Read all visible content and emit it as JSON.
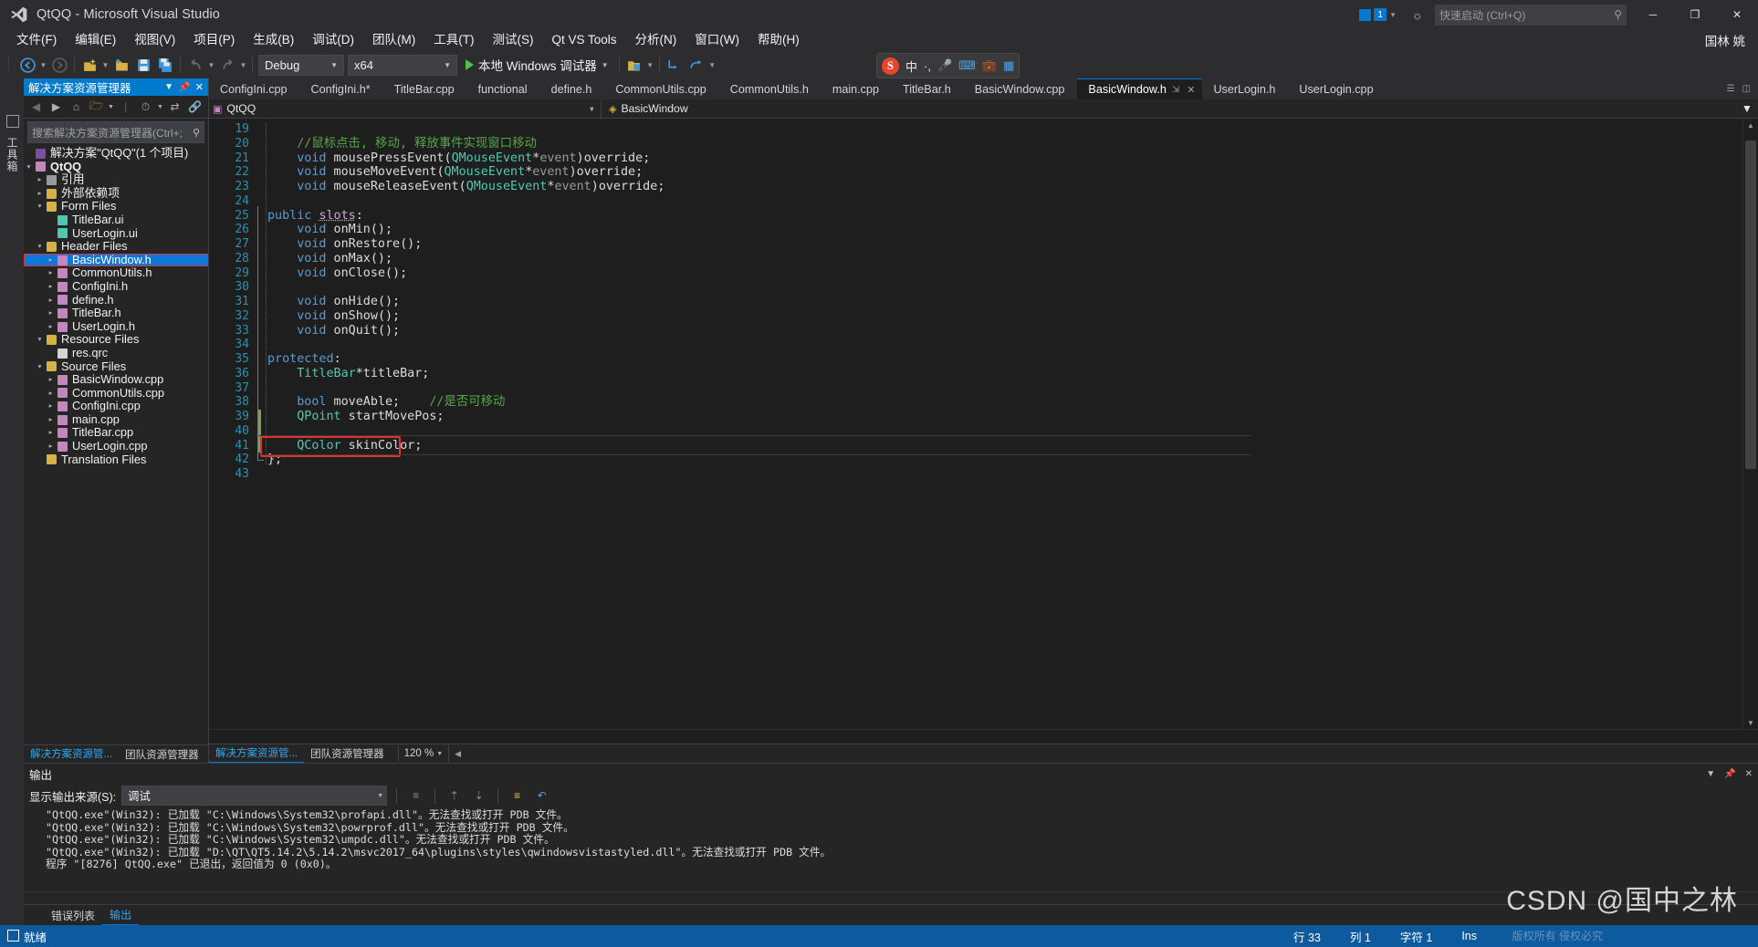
{
  "titlebar": {
    "title": "QtQQ - Microsoft Visual Studio",
    "notif_count": "1",
    "search_placeholder": "快速启动 (Ctrl+Q)",
    "minimize": "─",
    "maximize": "❐",
    "close": "✕"
  },
  "menubar": {
    "items": [
      {
        "label": "文件(F)"
      },
      {
        "label": "编辑(E)"
      },
      {
        "label": "视图(V)"
      },
      {
        "label": "项目(P)"
      },
      {
        "label": "生成(B)"
      },
      {
        "label": "调试(D)"
      },
      {
        "label": "团队(M)"
      },
      {
        "label": "工具(T)"
      },
      {
        "label": "测试(S)"
      },
      {
        "label": "Qt VS Tools"
      },
      {
        "label": "分析(N)"
      },
      {
        "label": "窗口(W)"
      },
      {
        "label": "帮助(H)"
      }
    ],
    "user": "国林 姚"
  },
  "toolbar": {
    "config": "Debug",
    "platform": "x64",
    "run_label": "本地 Windows 调试器",
    "sogou": {
      "logo": "S",
      "lang": "中",
      "dot": "·,"
    }
  },
  "solution_explorer": {
    "title": "解决方案资源管理器",
    "search_placeholder": "搜索解决方案资源管理器(Ctrl+;",
    "root": "解决方案\"QtQQ\"(1 个项目)",
    "project": "QtQQ",
    "tree": [
      {
        "label": "引用",
        "indent": 2,
        "arrow": "▸",
        "icon": "reference-icon",
        "color": "#9a9a9a"
      },
      {
        "label": "外部依赖项",
        "indent": 2,
        "arrow": "▸",
        "icon": "folder-icon",
        "color": "#d7b047"
      },
      {
        "label": "Form Files",
        "indent": 2,
        "arrow": "▾",
        "icon": "filter-folder-icon",
        "color": "#d7b047"
      },
      {
        "label": "TitleBar.ui",
        "indent": 3,
        "arrow": "",
        "icon": "ui-file-icon",
        "color": "#4ec9b0"
      },
      {
        "label": "UserLogin.ui",
        "indent": 3,
        "arrow": "",
        "icon": "ui-file-icon",
        "color": "#4ec9b0"
      },
      {
        "label": "Header Files",
        "indent": 2,
        "arrow": "▾",
        "icon": "filter-folder-icon",
        "color": "#d7b047"
      },
      {
        "label": "BasicWindow.h",
        "indent": 3,
        "arrow": "▸",
        "icon": "header-file-icon",
        "color": "#c586c0",
        "selected": true,
        "boxed": true
      },
      {
        "label": "CommonUtils.h",
        "indent": 3,
        "arrow": "▸",
        "icon": "header-file-icon",
        "color": "#c586c0"
      },
      {
        "label": "ConfigIni.h",
        "indent": 3,
        "arrow": "▸",
        "icon": "header-file-icon",
        "color": "#c586c0"
      },
      {
        "label": "define.h",
        "indent": 3,
        "arrow": "▸",
        "icon": "header-file-icon",
        "color": "#c586c0"
      },
      {
        "label": "TitleBar.h",
        "indent": 3,
        "arrow": "▸",
        "icon": "header-file-icon",
        "color": "#c586c0"
      },
      {
        "label": "UserLogin.h",
        "indent": 3,
        "arrow": "▸",
        "icon": "header-file-icon",
        "color": "#c586c0"
      },
      {
        "label": "Resource Files",
        "indent": 2,
        "arrow": "▾",
        "icon": "filter-folder-icon",
        "color": "#d7b047"
      },
      {
        "label": "res.qrc",
        "indent": 3,
        "arrow": "",
        "icon": "qrc-file-icon",
        "color": "#d4d4d4"
      },
      {
        "label": "Source Files",
        "indent": 2,
        "arrow": "▾",
        "icon": "filter-folder-icon",
        "color": "#d7b047"
      },
      {
        "label": "BasicWindow.cpp",
        "indent": 3,
        "arrow": "▸",
        "icon": "cpp-file-icon",
        "color": "#c586c0"
      },
      {
        "label": "CommonUtils.cpp",
        "indent": 3,
        "arrow": "▸",
        "icon": "cpp-file-icon",
        "color": "#c586c0"
      },
      {
        "label": "ConfigIni.cpp",
        "indent": 3,
        "arrow": "▸",
        "icon": "cpp-file-icon",
        "color": "#c586c0"
      },
      {
        "label": "main.cpp",
        "indent": 3,
        "arrow": "▸",
        "icon": "cpp-file-icon",
        "color": "#c586c0"
      },
      {
        "label": "TitleBar.cpp",
        "indent": 3,
        "arrow": "▸",
        "icon": "cpp-file-icon",
        "color": "#c586c0"
      },
      {
        "label": "UserLogin.cpp",
        "indent": 3,
        "arrow": "▸",
        "icon": "cpp-file-icon",
        "color": "#c586c0"
      },
      {
        "label": "Translation Files",
        "indent": 2,
        "arrow": "",
        "icon": "filter-folder-icon",
        "color": "#d7b047"
      }
    ],
    "bottom_tabs": [
      {
        "label": "解决方案资源管...",
        "active": true
      },
      {
        "label": "团队资源管理器",
        "active": false
      }
    ]
  },
  "editor": {
    "tabs": [
      {
        "label": "ConfigIni.cpp",
        "active": false
      },
      {
        "label": "ConfigIni.h*",
        "active": false
      },
      {
        "label": "TitleBar.cpp",
        "active": false
      },
      {
        "label": "functional",
        "active": false
      },
      {
        "label": "define.h",
        "active": false
      },
      {
        "label": "CommonUtils.cpp",
        "active": false
      },
      {
        "label": "CommonUtils.h",
        "active": false
      },
      {
        "label": "main.cpp",
        "active": false
      },
      {
        "label": "TitleBar.h",
        "active": false
      },
      {
        "label": "BasicWindow.cpp",
        "active": false
      },
      {
        "label": "BasicWindow.h",
        "active": true
      },
      {
        "label": "UserLogin.h",
        "active": false
      },
      {
        "label": "UserLogin.cpp",
        "active": false
      }
    ],
    "nav_project": "QtQQ",
    "nav_class": "BasicWindow",
    "zoom": "120 %",
    "bottom_tabs": [
      {
        "label": "解决方案资源管...",
        "active": true
      },
      {
        "label": "团队资源管理器",
        "active": false
      }
    ],
    "code_lines": [
      {
        "num": "19",
        "tokens": []
      },
      {
        "num": "20",
        "tokens": [
          {
            "t": "    //鼠标点击, 移动, 释放事件实现窗口移动",
            "c": "cmt"
          }
        ]
      },
      {
        "num": "21",
        "tokens": [
          {
            "t": "    ",
            "c": "pun"
          },
          {
            "t": "void",
            "c": "kw"
          },
          {
            "t": " mousePressEvent",
            "c": "idn"
          },
          {
            "t": "(",
            "c": "pun"
          },
          {
            "t": "QMouseEvent",
            "c": "typ"
          },
          {
            "t": "*",
            "c": "pun"
          },
          {
            "t": "event",
            "c": "par"
          },
          {
            "t": ")",
            "c": "pun"
          },
          {
            "t": "override",
            "c": "idn"
          },
          {
            "t": ";",
            "c": "pun"
          }
        ]
      },
      {
        "num": "22",
        "tokens": [
          {
            "t": "    ",
            "c": "pun"
          },
          {
            "t": "void",
            "c": "kw"
          },
          {
            "t": " mouseMoveEvent",
            "c": "idn"
          },
          {
            "t": "(",
            "c": "pun"
          },
          {
            "t": "QMouseEvent",
            "c": "typ"
          },
          {
            "t": "*",
            "c": "pun"
          },
          {
            "t": "event",
            "c": "par"
          },
          {
            "t": ")",
            "c": "pun"
          },
          {
            "t": "override",
            "c": "idn"
          },
          {
            "t": ";",
            "c": "pun"
          }
        ]
      },
      {
        "num": "23",
        "tokens": [
          {
            "t": "    ",
            "c": "pun"
          },
          {
            "t": "void",
            "c": "kw"
          },
          {
            "t": " mouseReleaseEvent",
            "c": "idn"
          },
          {
            "t": "(",
            "c": "pun"
          },
          {
            "t": "QMouseEvent",
            "c": "typ"
          },
          {
            "t": "*",
            "c": "pun"
          },
          {
            "t": "event",
            "c": "par"
          },
          {
            "t": ")",
            "c": "pun"
          },
          {
            "t": "override",
            "c": "idn"
          },
          {
            "t": ";",
            "c": "pun"
          }
        ]
      },
      {
        "num": "24",
        "tokens": []
      },
      {
        "num": "25",
        "tokens": [
          {
            "t": "public",
            "c": "kw"
          },
          {
            "t": " ",
            "c": "pun"
          },
          {
            "t": "slots",
            "c": "kw2 sq"
          },
          {
            "t": ":",
            "c": "pun"
          }
        ]
      },
      {
        "num": "26",
        "tokens": [
          {
            "t": "    ",
            "c": "pun"
          },
          {
            "t": "void",
            "c": "kw"
          },
          {
            "t": " onMin",
            "c": "idn"
          },
          {
            "t": "();",
            "c": "pun"
          }
        ]
      },
      {
        "num": "27",
        "tokens": [
          {
            "t": "    ",
            "c": "pun"
          },
          {
            "t": "void",
            "c": "kw"
          },
          {
            "t": " onRestore",
            "c": "idn"
          },
          {
            "t": "();",
            "c": "pun"
          }
        ]
      },
      {
        "num": "28",
        "tokens": [
          {
            "t": "    ",
            "c": "pun"
          },
          {
            "t": "void",
            "c": "kw"
          },
          {
            "t": " onMax",
            "c": "idn"
          },
          {
            "t": "();",
            "c": "pun"
          }
        ]
      },
      {
        "num": "29",
        "tokens": [
          {
            "t": "    ",
            "c": "pun"
          },
          {
            "t": "void",
            "c": "kw"
          },
          {
            "t": " onClose",
            "c": "idn"
          },
          {
            "t": "();",
            "c": "pun"
          }
        ]
      },
      {
        "num": "30",
        "tokens": []
      },
      {
        "num": "31",
        "tokens": [
          {
            "t": "    ",
            "c": "pun"
          },
          {
            "t": "void",
            "c": "kw"
          },
          {
            "t": " onHide",
            "c": "idn"
          },
          {
            "t": "();",
            "c": "pun"
          }
        ]
      },
      {
        "num": "32",
        "tokens": [
          {
            "t": "    ",
            "c": "pun"
          },
          {
            "t": "void",
            "c": "kw"
          },
          {
            "t": " onShow",
            "c": "idn"
          },
          {
            "t": "();",
            "c": "pun"
          }
        ]
      },
      {
        "num": "33",
        "tokens": [
          {
            "t": "    ",
            "c": "pun"
          },
          {
            "t": "void",
            "c": "kw"
          },
          {
            "t": " onQuit",
            "c": "idn"
          },
          {
            "t": "();",
            "c": "pun"
          }
        ]
      },
      {
        "num": "34",
        "tokens": []
      },
      {
        "num": "35",
        "tokens": [
          {
            "t": "protected",
            "c": "kw"
          },
          {
            "t": ":",
            "c": "pun"
          }
        ]
      },
      {
        "num": "36",
        "tokens": [
          {
            "t": "    ",
            "c": "pun"
          },
          {
            "t": "TitleBar",
            "c": "typ"
          },
          {
            "t": "*titleBar;",
            "c": "idn"
          }
        ]
      },
      {
        "num": "37",
        "tokens": []
      },
      {
        "num": "38",
        "tokens": [
          {
            "t": "    ",
            "c": "pun"
          },
          {
            "t": "bool",
            "c": "kw"
          },
          {
            "t": " moveAble;",
            "c": "idn"
          },
          {
            "t": "    //是否可移动",
            "c": "cmt"
          }
        ]
      },
      {
        "num": "39",
        "tokens": [
          {
            "t": "    ",
            "c": "pun"
          },
          {
            "t": "QPoint",
            "c": "typ"
          },
          {
            "t": " startMovePos;",
            "c": "idn"
          }
        ],
        "changed": true
      },
      {
        "num": "40",
        "tokens": [],
        "changed": true
      },
      {
        "num": "41",
        "tokens": [
          {
            "t": "    ",
            "c": "pun"
          },
          {
            "t": "QColor",
            "c": "typ"
          },
          {
            "t": " skinColor;",
            "c": "idn"
          }
        ],
        "changed": true,
        "highlight": true,
        "current": true
      },
      {
        "num": "42",
        "tokens": [
          {
            "t": "};",
            "c": "pun"
          }
        ]
      },
      {
        "num": "43",
        "tokens": []
      }
    ]
  },
  "output": {
    "title": "输出",
    "source_label": "显示输出来源(S):",
    "source_value": "调试",
    "lines": [
      "\"QtQQ.exe\"(Win32): 已加载 \"C:\\Windows\\System32\\profapi.dll\"。无法查找或打开 PDB 文件。",
      "\"QtQQ.exe\"(Win32): 已加载 \"C:\\Windows\\System32\\powrprof.dll\"。无法查找或打开 PDB 文件。",
      "\"QtQQ.exe\"(Win32): 已加载 \"C:\\Windows\\System32\\umpdc.dll\"。无法查找或打开 PDB 文件。",
      "\"QtQQ.exe\"(Win32): 已加载 \"D:\\QT\\QT5.14.2\\5.14.2\\msvc2017_64\\plugins\\styles\\qwindowsvistastyled.dll\"。无法查找或打开 PDB 文件。",
      "程序 \"[8276] QtQQ.exe\" 已退出，返回值为 0 (0x0)。"
    ],
    "tabs": [
      {
        "label": "错误列表",
        "active": false
      },
      {
        "label": "输出",
        "active": true
      }
    ]
  },
  "statusbar": {
    "ready": "就绪",
    "row": "行 33",
    "col": "列 1",
    "char": "字符 1",
    "ins": "Ins"
  },
  "watermark": {
    "main": "CSDN @国中之林",
    "sub": "版权所有 侵权必究"
  },
  "colors": {
    "accent": "#007acc",
    "status_bar": "#0d5a9e",
    "selection": "#0d78d7",
    "highlight_box": "#e03030",
    "editor_bg": "#1e1e1e",
    "chrome_bg": "#2d2d30",
    "panel_bg": "#252526"
  }
}
